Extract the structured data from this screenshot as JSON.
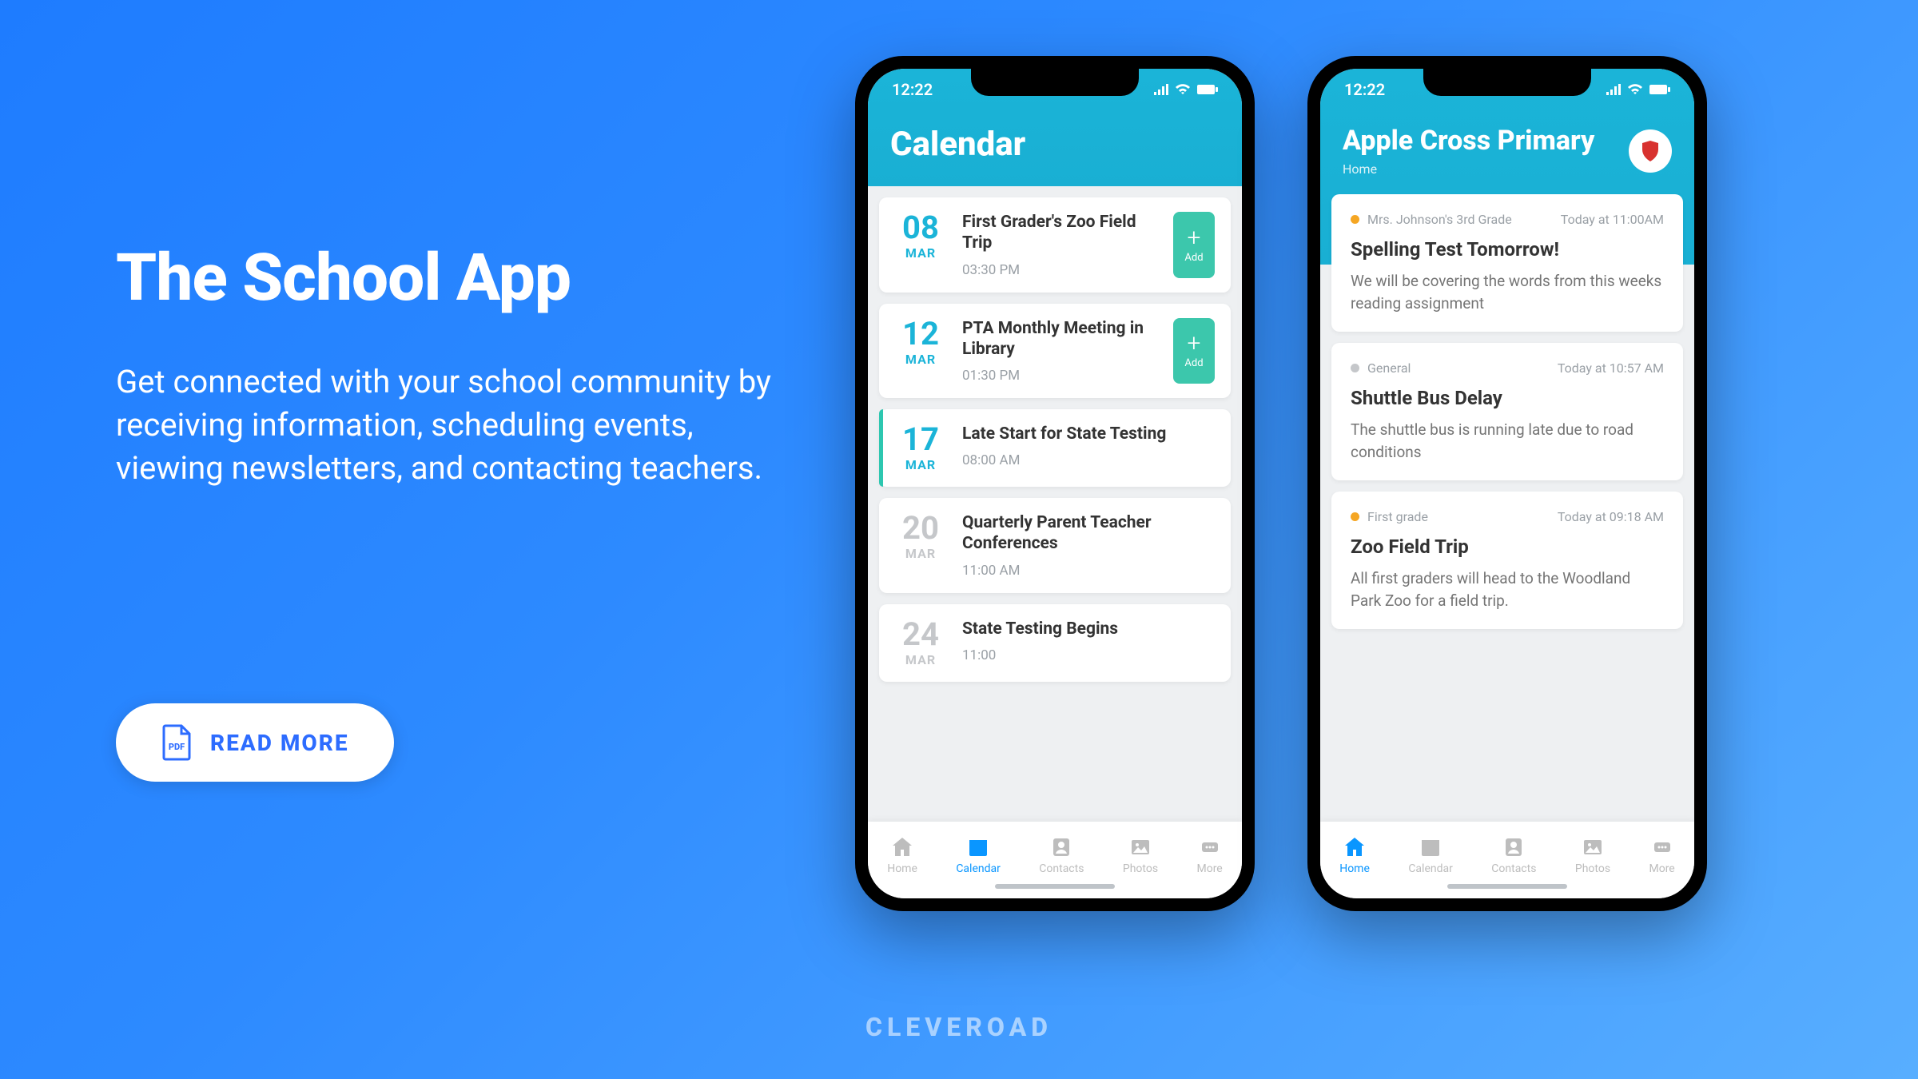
{
  "hero": {
    "title": "The School App",
    "desc": "Get connected with your school community by receiving information, scheduling events, viewing newsletters, and contacting teachers.",
    "cta": "READ MORE"
  },
  "brand": "CLEVEROAD",
  "status_time": "12:22",
  "phone1": {
    "title": "Calendar",
    "events": [
      {
        "day": "08",
        "mon": "MAR",
        "title": "First Grader's Zoo Field Trip",
        "time": "03:30 PM",
        "add": true,
        "active": true
      },
      {
        "day": "12",
        "mon": "MAR",
        "title": "PTA Monthly Meeting in Library",
        "time": "01:30 PM",
        "add": true,
        "active": true
      },
      {
        "day": "17",
        "mon": "MAR",
        "title": "Late Start for State Testing",
        "time": "08:00 AM",
        "add": false,
        "active": true,
        "bar": true
      },
      {
        "day": "20",
        "mon": "MAR",
        "title": "Quarterly Parent Teacher Conferences",
        "time": "11:00 AM",
        "add": false,
        "active": false
      },
      {
        "day": "24",
        "mon": "MAR",
        "title": "State Testing Begins",
        "time": "11:00",
        "add": false,
        "active": false
      }
    ],
    "tabs": [
      "Home",
      "Calendar",
      "Contacts",
      "Photos",
      "More"
    ],
    "active_tab": 1,
    "add_label": "Add"
  },
  "phone2": {
    "title": "Apple Cross Primary",
    "sub": "Home",
    "posts": [
      {
        "cat": "Mrs. Johnson's 3rd Grade",
        "dot": "o",
        "when": "Today at 11:00AM",
        "title": "Spelling Test Tomorrow!",
        "body": "We will be covering the words from this weeks reading assignment"
      },
      {
        "cat": "General",
        "dot": "g",
        "when": "Today at 10:57 AM",
        "title": "Shuttle Bus Delay",
        "body": "The shuttle bus is running late due to road conditions"
      },
      {
        "cat": "First grade",
        "dot": "o",
        "when": "Today at 09:18 AM",
        "title": "Zoo Field Trip",
        "body": "All first graders will head to the Woodland Park Zoo for a field trip."
      }
    ],
    "tabs": [
      "Home",
      "Calendar",
      "Contacts",
      "Photos",
      "More"
    ],
    "active_tab": 0
  }
}
